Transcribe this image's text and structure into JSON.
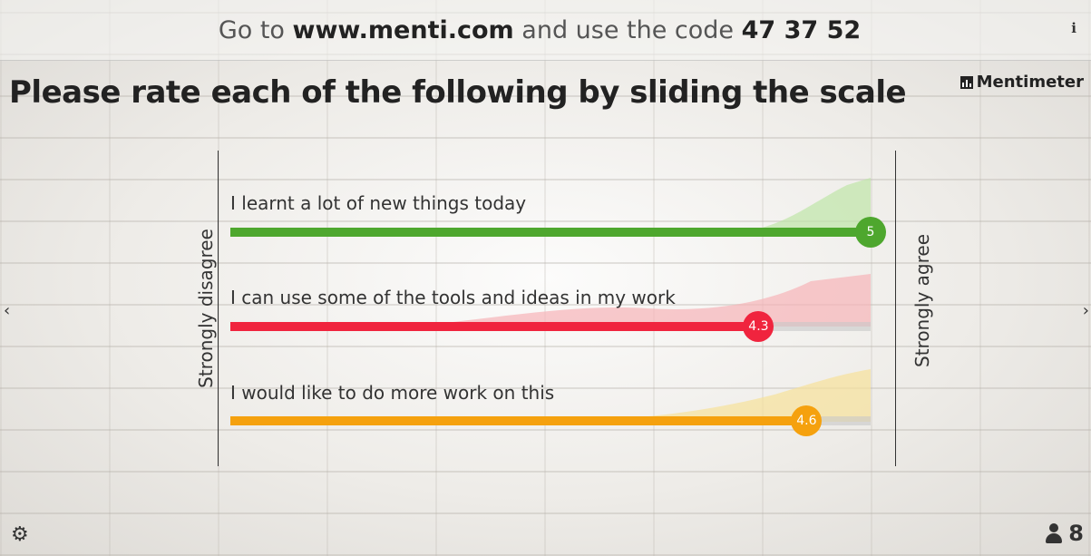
{
  "header": {
    "prefix": "Go to",
    "url": "www.menti.com",
    "middle": "and use the code",
    "code": "47 37 52",
    "info_icon": "i"
  },
  "title": "Please rate each of the following by sliding the scale",
  "brand": "Mentimeter",
  "scale": {
    "min_label": "Strongly disagree",
    "max_label": "Strongly agree",
    "min": 1,
    "max": 5
  },
  "items": [
    {
      "label": "I learnt a lot of new things today",
      "value": 5,
      "value_text": "5",
      "color": "#4ea72e",
      "dist_color": "#bfe6a8"
    },
    {
      "label": "I can use some of the tools and ideas in my work",
      "value": 4.3,
      "value_text": "4.3",
      "color": "#f0243e",
      "dist_color": "#f7b4b8"
    },
    {
      "label": "I would like to do more work on this",
      "value": 4.6,
      "value_text": "4.6",
      "color": "#f5a10e",
      "dist_color": "#f6e19a"
    }
  ],
  "footer": {
    "settings_icon": "gear-icon",
    "participants_icon": "person-icon",
    "participants_count": "8"
  },
  "nav": {
    "prev_icon": "‹",
    "next_icon": "›"
  }
}
